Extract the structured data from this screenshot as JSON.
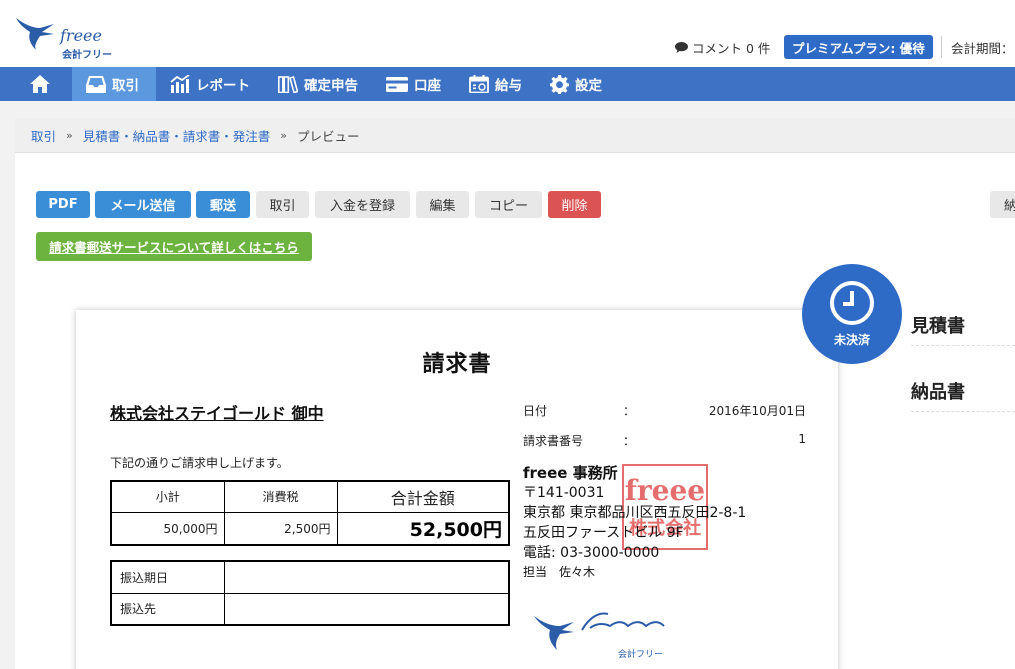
{
  "header": {
    "logo_text": "freee",
    "logo_sub": "会計フリー",
    "comment": "コメント 0 件",
    "plan": "プレミアムプラン: 優待",
    "period": "会計期間："
  },
  "nav": {
    "items": [
      {
        "label": "",
        "icon": "home-icon"
      },
      {
        "label": "取引",
        "icon": "inbox-icon"
      },
      {
        "label": "レポート",
        "icon": "chart-icon"
      },
      {
        "label": "確定申告",
        "icon": "books-icon"
      },
      {
        "label": "口座",
        "icon": "card-icon"
      },
      {
        "label": "給与",
        "icon": "calendar-icon"
      },
      {
        "label": "設定",
        "icon": "gear-icon"
      }
    ]
  },
  "breadcrumb": {
    "items": [
      "取引",
      "見積書・納品書・請求書・発注書",
      "プレビュー"
    ],
    "separator": "»"
  },
  "toolbar": {
    "pdf": "PDF",
    "mail": "メール送信",
    "post": "郵送",
    "deal": "取引",
    "payment": "入金を登録",
    "edit": "編集",
    "copy": "コピー",
    "delete": "削除",
    "cut": "納",
    "mail_service": "請求書郵送サービスについて詳しくはこちら"
  },
  "status": {
    "label": "未決済"
  },
  "invoice": {
    "title": "請求書",
    "client": "株式会社ステイゴールド 御中",
    "intro": "下記の通りご請求申し上げます。",
    "summary_headers": [
      "小計",
      "消費税",
      "合計金額"
    ],
    "summary_values": [
      "50,000円",
      "2,500円",
      "52,500円"
    ],
    "payment_labels": [
      "振込期日",
      "振込先"
    ],
    "date_label": "日付",
    "date_value": "2016年10月01日",
    "number_label": "請求書番号",
    "number_value": "1",
    "colon": "：",
    "issuer_name": "freee 事務所",
    "issuer_zip": "〒141-0031",
    "issuer_addr1": "東京都 東京都品川区西五反田2-8-1",
    "issuer_addr2": "五反田ファーストビル 9F",
    "issuer_tel": "電話: 03-3000-0000",
    "issuer_person": "担当　佐々木",
    "stamp_top": "freee",
    "stamp_bottom": "株式会社",
    "footer_logo_sub": "会計フリー"
  },
  "side": {
    "items": [
      "見積書",
      "納品書"
    ]
  },
  "colors": {
    "nav": "#3d72c4",
    "nav_active": "#5b98de",
    "primary_button": "#3a8ed8",
    "delete_button": "#dc5353",
    "mail_link": "#6db33f",
    "status": "#2e6bc6",
    "stamp": "#dc3c3c"
  }
}
